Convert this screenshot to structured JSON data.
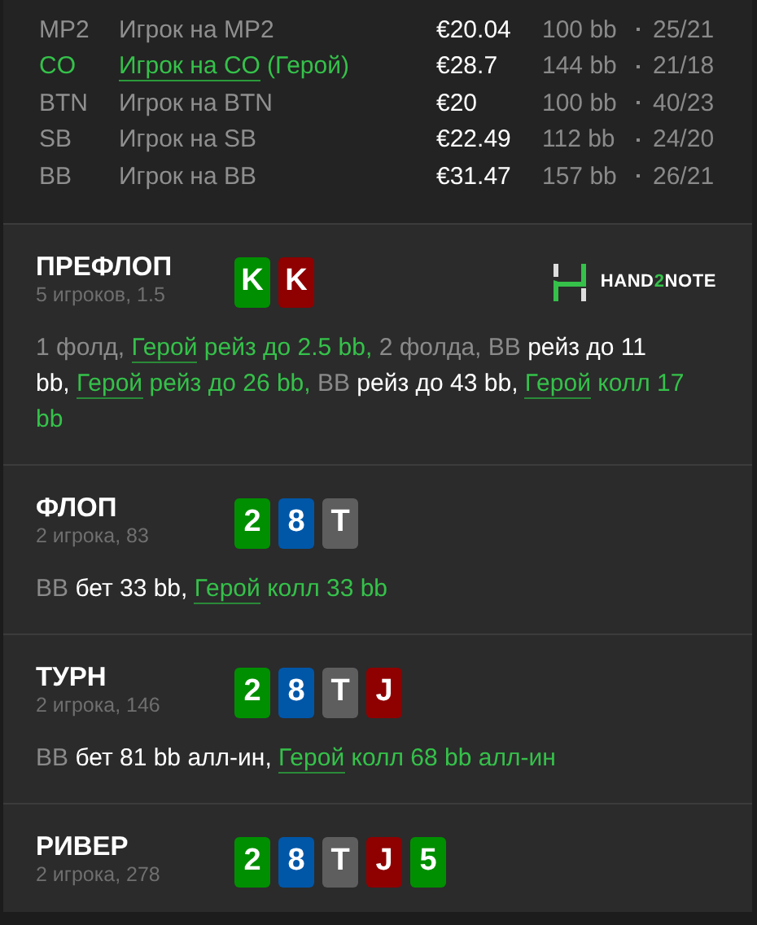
{
  "players": [
    {
      "position": "MP2",
      "name": "Игрок на MP2",
      "hero": false,
      "stack": "€20.04",
      "bb": "100 bb",
      "stats": "25/21"
    },
    {
      "position": "CO",
      "name": "Игрок на CO",
      "tag": "(Герой)",
      "hero": true,
      "stack": "€28.7",
      "bb": "144 bb",
      "stats": "21/18"
    },
    {
      "position": "BTN",
      "name": "Игрок на BTN",
      "hero": false,
      "stack": "€20",
      "bb": "100 bb",
      "stats": "40/23"
    },
    {
      "position": "SB",
      "name": "Игрок на SB",
      "hero": false,
      "stack": "€22.49",
      "bb": "112 bb",
      "stats": "24/20"
    },
    {
      "position": "BB",
      "name": "Игрок на BB",
      "hero": false,
      "stack": "€31.47",
      "bb": "157 bb",
      "stats": "26/21"
    }
  ],
  "logo": {
    "before": "HAND",
    "accent": "2",
    "after": "NOTE"
  },
  "streets": [
    {
      "title": "ПРЕФЛОП",
      "subtitle": "5 игроков, 1.5",
      "logo": true,
      "cards": [
        {
          "rank": "K",
          "color": "#008f00"
        },
        {
          "rank": "K",
          "color": "#8f0000"
        }
      ],
      "actions": [
        {
          "kind": "grey",
          "text": "1 фолд, "
        },
        {
          "kind": "link",
          "text": "Герой"
        },
        {
          "kind": "green",
          "text": " рейз до 2.5 bb, "
        },
        {
          "kind": "grey",
          "text": "2 фолда, BB "
        },
        {
          "kind": "white",
          "text": "рейз до 11 bb, "
        },
        {
          "kind": "link",
          "text": "Герой"
        },
        {
          "kind": "green",
          "text": " рейз до 26 bb, "
        },
        {
          "kind": "grey",
          "text": "BB "
        },
        {
          "kind": "white",
          "text": "рейз до 43 bb, "
        },
        {
          "kind": "link",
          "text": "Герой"
        },
        {
          "kind": "green",
          "text": " колл 17 bb"
        }
      ]
    },
    {
      "title": "ФЛОП",
      "subtitle": "2 игрока, 83",
      "logo": false,
      "cards": [
        {
          "rank": "2",
          "color": "#008f00"
        },
        {
          "rank": "8",
          "color": "#0057a8"
        },
        {
          "rank": "T",
          "color": "#5e5e5e"
        }
      ],
      "actions": [
        {
          "kind": "grey",
          "text": "BB "
        },
        {
          "kind": "white",
          "text": "бет 33 bb, "
        },
        {
          "kind": "link",
          "text": "Герой"
        },
        {
          "kind": "green",
          "text": " колл 33 bb"
        }
      ]
    },
    {
      "title": "ТУРН",
      "subtitle": "2 игрока, 146",
      "logo": false,
      "cards": [
        {
          "rank": "2",
          "color": "#008f00"
        },
        {
          "rank": "8",
          "color": "#0057a8"
        },
        {
          "rank": "T",
          "color": "#5e5e5e"
        },
        {
          "rank": "J",
          "color": "#8f0000"
        }
      ],
      "actions": [
        {
          "kind": "grey",
          "text": "BB "
        },
        {
          "kind": "white",
          "text": "бет 81 bb алл-ин, "
        },
        {
          "kind": "link",
          "text": "Герой"
        },
        {
          "kind": "green",
          "text": " колл 68 bb алл-ин"
        }
      ]
    },
    {
      "title": "РИВЕР",
      "subtitle": "2 игрока, 278",
      "logo": false,
      "cards": [
        {
          "rank": "2",
          "color": "#008f00"
        },
        {
          "rank": "8",
          "color": "#0057a8"
        },
        {
          "rank": "T",
          "color": "#5e5e5e"
        },
        {
          "rank": "J",
          "color": "#8f0000"
        },
        {
          "rank": "5",
          "color": "#008f00"
        }
      ]
    }
  ]
}
